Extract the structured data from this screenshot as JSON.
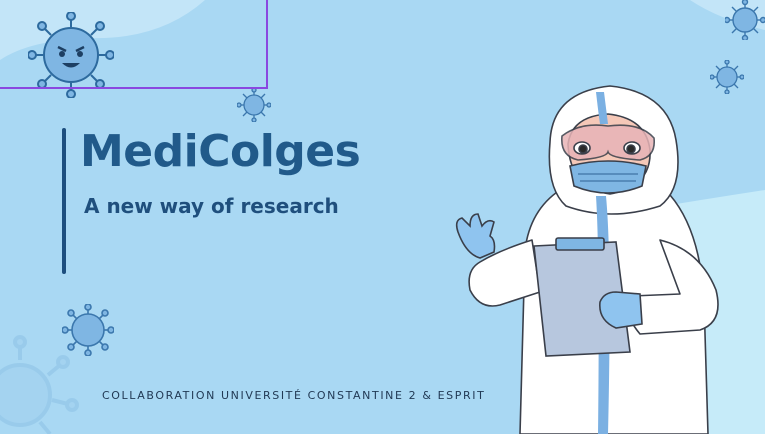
{
  "slide": {
    "title": "MediColges",
    "subtitle": "A new way of research",
    "footer": "COLLABORATION UNIVERSITÉ CONSTANTINE 2 & ESPRIT"
  },
  "colors": {
    "background": "#a9d8f3",
    "title": "#215a8a",
    "accent_bar": "#1d4e7e",
    "virus": "#7fb6e3",
    "selection": "#8a48e0"
  },
  "icons": [
    "virus-icon",
    "happy-virus-icon",
    "doctor-illustration",
    "clipboard-icon"
  ]
}
